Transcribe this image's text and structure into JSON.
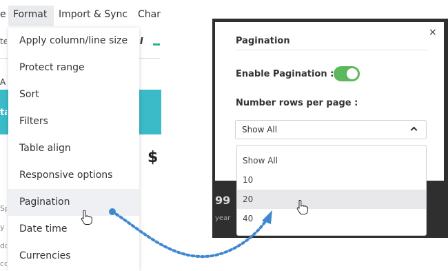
{
  "menubar": {
    "cut_left": "e",
    "format": "Format",
    "import_sync": "Import & Sync",
    "charts_partial": "Char"
  },
  "toolbar": {
    "cut_left": "te",
    "italic": "I"
  },
  "sheet": {
    "column_a": "A",
    "band_cut": "ta",
    "dollar": "$",
    "side_fragments": [
      "Sp",
      "y",
      "dd",
      "cc"
    ]
  },
  "format_menu": {
    "items": [
      "Apply column/line size",
      "Protect range",
      "Sort",
      "Filters",
      "Table align",
      "Responsive options",
      "Pagination",
      "Date time",
      "Currencies"
    ],
    "hovered": "Pagination"
  },
  "pagination_modal": {
    "title": "Pagination",
    "close": "×",
    "enable_label": "Enable Pagination :",
    "enabled": true,
    "rows_label": "Number rows per page :",
    "selected": "Show All",
    "options": [
      "Show All",
      "10",
      "20",
      "40"
    ],
    "hovered_option": "20",
    "background_text": "99",
    "background_small": "year"
  },
  "colors": {
    "teal": "#3bbac8",
    "toggle_on": "#5cb85c",
    "arrow": "#3f88d0",
    "dark_frame": "#2f2f2f"
  },
  "icons": [
    "hand-cursor-icon",
    "close-icon",
    "chevron-up-icon"
  ]
}
